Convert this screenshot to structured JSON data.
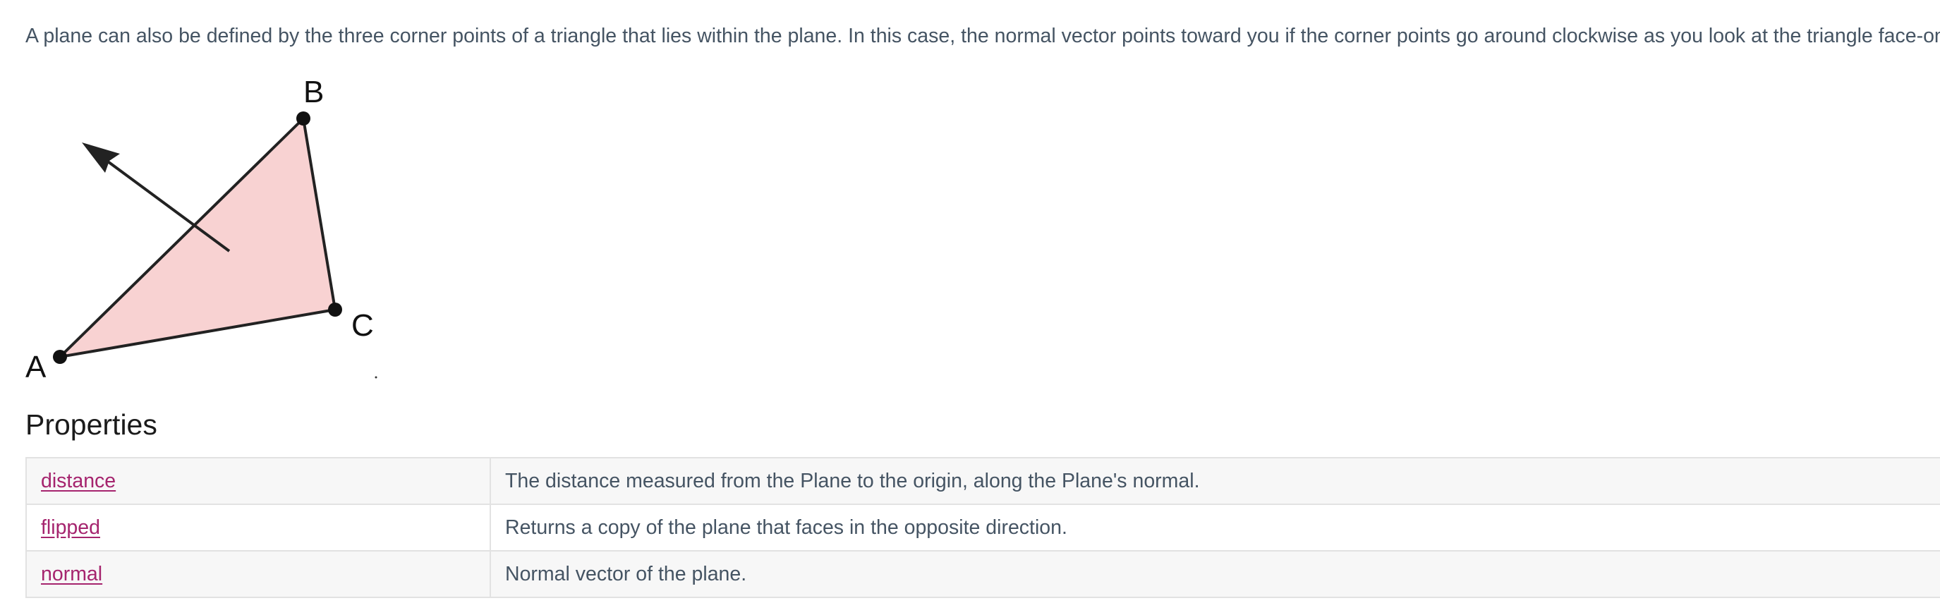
{
  "intro": {
    "text": "A plane can also be defined by the three corner points of a triangle that lies within the plane. In this case, the normal vector points toward you if the corner points go around clockwise as you look at the triangle face-on."
  },
  "figure": {
    "labels": {
      "a": "A",
      "b": "B",
      "c": "C"
    },
    "colors": {
      "triangle_fill": "#f8d2d2",
      "stroke": "#222222"
    }
  },
  "properties": {
    "heading": "Properties",
    "rows": [
      {
        "name": "distance",
        "description": "The distance measured from the Plane to the origin, along the Plane's normal."
      },
      {
        "name": "flipped",
        "description": "Returns a copy of the plane that faces in the opposite direction."
      },
      {
        "name": "normal",
        "description": "Normal vector of the plane."
      }
    ],
    "colors": {
      "link": "#a5246e",
      "text": "#455463",
      "row_alt": "#f7f7f7",
      "border": "#e2e2e2"
    }
  }
}
